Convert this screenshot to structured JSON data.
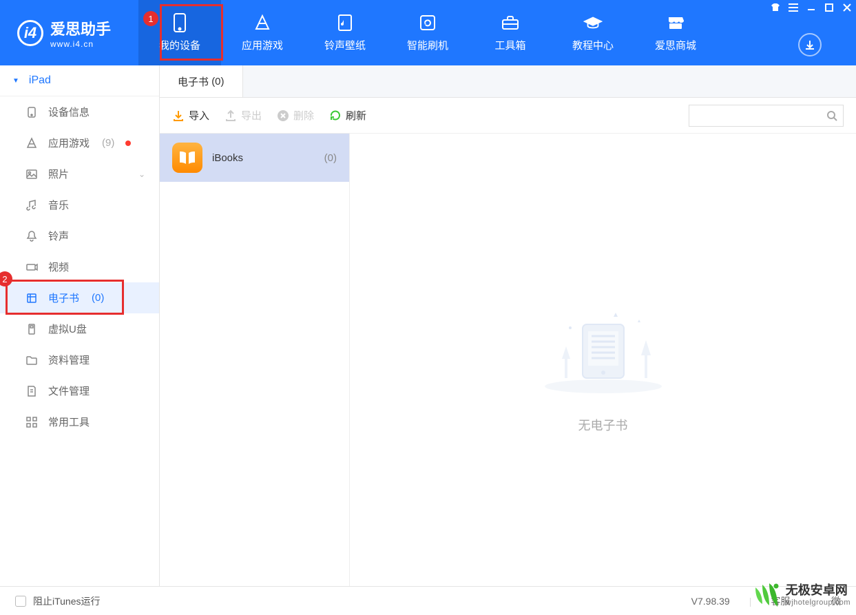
{
  "logo": {
    "title": "爱思助手",
    "sub": "www.i4.cn"
  },
  "nav": [
    {
      "label": "我的设备",
      "icon": "phone"
    },
    {
      "label": "应用游戏",
      "icon": "apps"
    },
    {
      "label": "铃声壁纸",
      "icon": "music-file"
    },
    {
      "label": "智能刷机",
      "icon": "refresh-box"
    },
    {
      "label": "工具箱",
      "icon": "toolbox"
    },
    {
      "label": "教程中心",
      "icon": "grad-cap"
    },
    {
      "label": "爱思商城",
      "icon": "store"
    }
  ],
  "markers": {
    "m1": "1",
    "m2": "2"
  },
  "device": {
    "name": "iPad"
  },
  "sidebar": [
    {
      "label": "设备信息"
    },
    {
      "label": "应用游戏",
      "count": "(9)",
      "dot": true
    },
    {
      "label": "照片",
      "chev": true
    },
    {
      "label": "音乐"
    },
    {
      "label": "铃声"
    },
    {
      "label": "视频"
    },
    {
      "label": "电子书",
      "count": "(0)",
      "selected": true,
      "marker": true
    },
    {
      "label": "虚拟U盘"
    },
    {
      "label": "资料管理"
    },
    {
      "label": "文件管理"
    },
    {
      "label": "常用工具"
    }
  ],
  "tab": {
    "label": "电子书",
    "count": "(0)"
  },
  "toolbar": {
    "import": "导入",
    "export": "导出",
    "delete": "删除",
    "refresh": "刷新"
  },
  "list": [
    {
      "name": "iBooks",
      "count": "(0)"
    }
  ],
  "empty": {
    "text": "无电子书"
  },
  "footer": {
    "itunes": "阻止iTunes运行",
    "version": "V7.98.39",
    "service": "客服",
    "wechat": "微"
  },
  "watermark": {
    "title": "无极安卓网",
    "sub": "wjhotelgroup.com"
  }
}
